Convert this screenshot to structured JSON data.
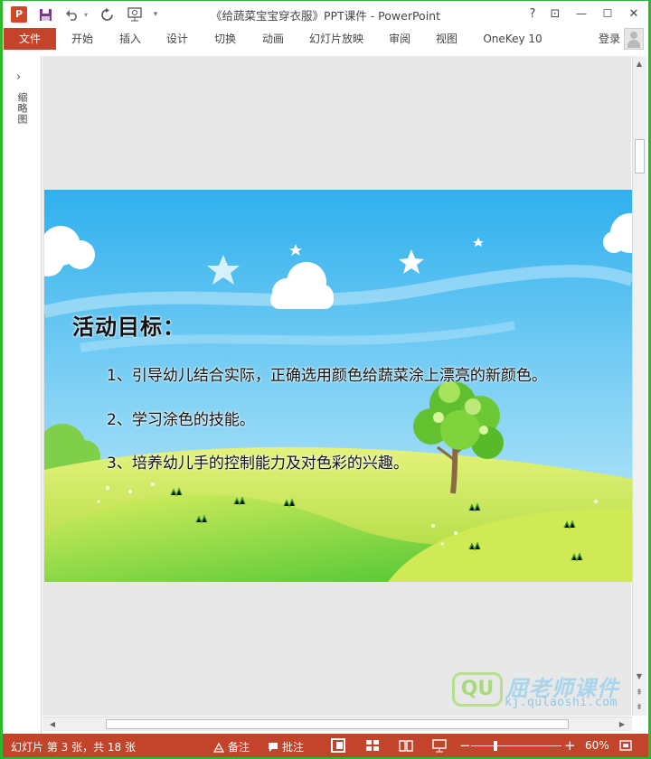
{
  "window": {
    "title": "《给蔬菜宝宝穿衣服》PPT课件 - PowerPoint",
    "app_icon_letter": "P",
    "help": "?",
    "restore_ribbon": "⊡",
    "minimize": "—",
    "maximize": "☐",
    "close": "✕"
  },
  "quick_access": {
    "save_icon": "save-icon",
    "undo_icon": "undo-icon",
    "redo_icon": "redo-icon",
    "present_icon": "start-from-beginning-icon",
    "customize_icon": "customize-icon"
  },
  "ribbon": {
    "tabs": [
      {
        "label": "文件",
        "active": true
      },
      {
        "label": "开始"
      },
      {
        "label": "插入"
      },
      {
        "label": "设计"
      },
      {
        "label": "切换"
      },
      {
        "label": "动画"
      },
      {
        "label": "幻灯片放映"
      },
      {
        "label": "审阅"
      },
      {
        "label": "视图"
      },
      {
        "label": "OneKey 10"
      }
    ],
    "login": "登录"
  },
  "thumbnails": {
    "label": "缩略图",
    "chevron": "›"
  },
  "slide": {
    "heading": "活动目标：",
    "items": [
      "1、引导幼儿结合实际，正确选用颜色给蔬菜涂上漂亮的新颜色。",
      "2、学习涂色的技能。",
      "3、培养幼儿手的控制能力及对色彩的兴趣。"
    ],
    "sky_color": "#3fb8ef",
    "grass_color": "#9bd63c"
  },
  "watermark": {
    "logo": "QU",
    "title": "屈老师课件",
    "url": "kj.qulaoshi.com"
  },
  "statusbar": {
    "slide_info": "幻灯片 第 3 张，共 18 张",
    "notes": "备注",
    "comments": "批注",
    "zoom_minus": "−",
    "zoom_plus": "+",
    "zoom": "60%",
    "zoom_fraction": 0.27
  }
}
